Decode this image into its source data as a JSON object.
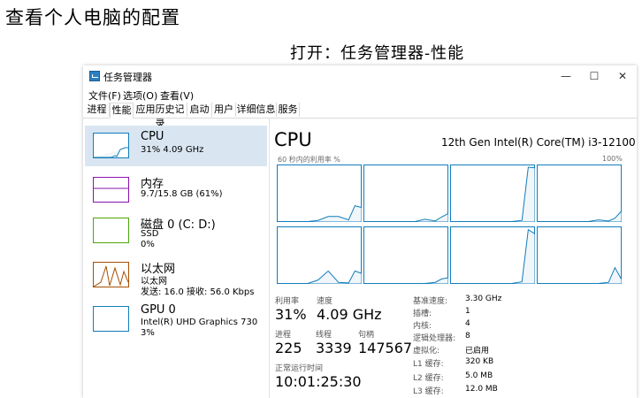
{
  "heading": "查看个人电脑的配置",
  "subheading": "打开：任务管理器-性能",
  "window": {
    "title": "任务管理器",
    "buttons": {
      "minimize": "—",
      "maximize": "☐",
      "close": "✕"
    }
  },
  "menu": [
    "文件(F)",
    "选项(O)",
    "查看(V)"
  ],
  "tabs": [
    "进程",
    "性能",
    "应用历史记录",
    "启动",
    "用户",
    "详细信息",
    "服务"
  ],
  "sidebar": {
    "items": [
      {
        "title": "CPU",
        "lines": [
          "31%  4.09 GHz"
        ],
        "color": "#117dbb"
      },
      {
        "title": "内存",
        "lines": [
          "9.7/15.8 GB (61%)"
        ],
        "color": "#8b12ae"
      },
      {
        "title": "磁盘 0 (C: D:)",
        "lines": [
          "SSD",
          "0%"
        ],
        "color": "#4da60c"
      },
      {
        "title": "以太网",
        "lines": [
          "以太网",
          "发送: 16.0  接收: 56.0 Kbps"
        ],
        "color": "#a74f01"
      },
      {
        "title": "GPU 0",
        "lines": [
          "Intel(R) UHD Graphics 730",
          "3%"
        ],
        "color": "#117dbb"
      }
    ]
  },
  "main": {
    "title": "CPU",
    "model": "12th Gen Intel(R) Core(TM) i3-12100",
    "graph_caption": "60 秒内的利用率 %",
    "graph_max": "100%",
    "graph_color": "#117dbb",
    "graph_fill": "#f1f6fa",
    "cores": [
      [
        0,
        0,
        0,
        0,
        2,
        9,
        9,
        3,
        28,
        25
      ],
      [
        0,
        0,
        0,
        0,
        0,
        0,
        4,
        1,
        8,
        14
      ],
      [
        0,
        0,
        0,
        0,
        0,
        0,
        0,
        2,
        96,
        95
      ],
      [
        0,
        0,
        0,
        0,
        0,
        0,
        3,
        1,
        6,
        18
      ],
      [
        0,
        0,
        0,
        0,
        6,
        22,
        2,
        1,
        22,
        18
      ],
      [
        0,
        0,
        0,
        0,
        0,
        0,
        0,
        2,
        8,
        10
      ],
      [
        0,
        0,
        0,
        0,
        0,
        0,
        0,
        3,
        95,
        88
      ],
      [
        0,
        0,
        0,
        0,
        0,
        0,
        0,
        2,
        28,
        8
      ]
    ]
  },
  "stats": {
    "utilization": {
      "label": "利用率",
      "value": "31%"
    },
    "speed": {
      "label": "速度",
      "value": "4.09 GHz"
    },
    "processes": {
      "label": "进程",
      "value": "225"
    },
    "threads": {
      "label": "线程",
      "value": "3339"
    },
    "handles": {
      "label": "句柄",
      "value": "147567"
    },
    "uptime": {
      "label": "正常运行时间",
      "value": "10:01:25:30"
    }
  },
  "details": [
    {
      "label": "基准速度:",
      "value": "3.30 GHz"
    },
    {
      "label": "插槽:",
      "value": "1"
    },
    {
      "label": "内核:",
      "value": "4"
    },
    {
      "label": "逻辑处理器:",
      "value": "8"
    },
    {
      "label": "虚拟化:",
      "value": "已启用"
    },
    {
      "label": "L1 缓存:",
      "value": "320 KB"
    },
    {
      "label": "L2 缓存:",
      "value": "5.0 MB"
    },
    {
      "label": "L3 缓存:",
      "value": "12.0 MB"
    }
  ]
}
